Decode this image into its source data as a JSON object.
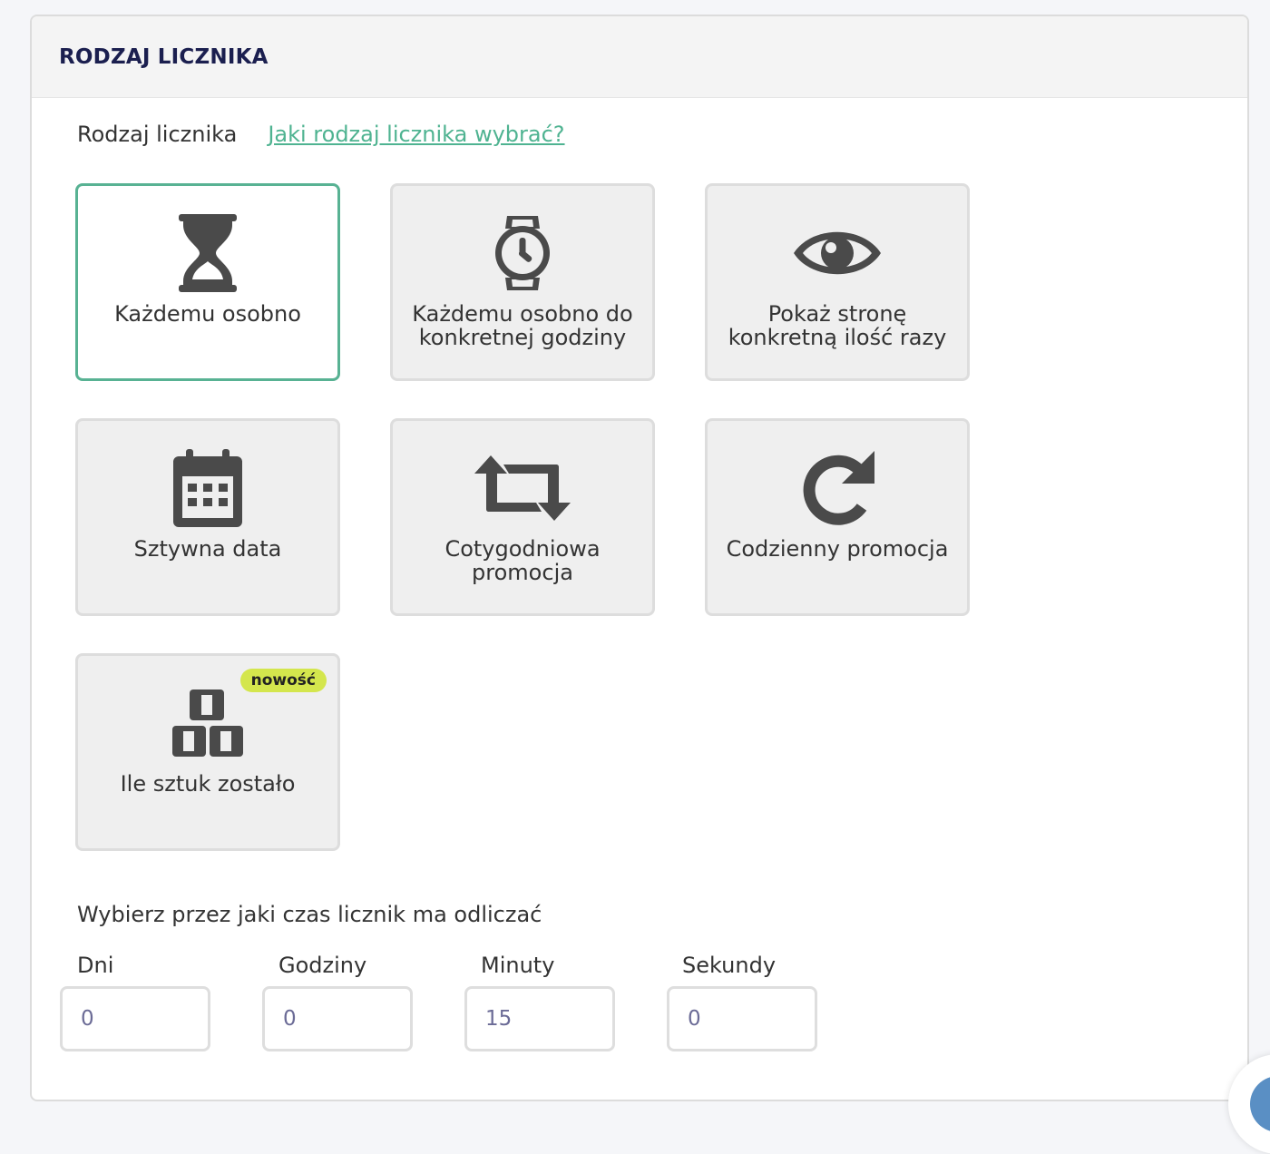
{
  "header": {
    "title": "RODZAJ LICZNIKA"
  },
  "type_section": {
    "label": "Rodzaj licznika",
    "help_link": "Jaki rodzaj licznika wybrać?"
  },
  "tiles": [
    {
      "label": "Każdemu osobno",
      "icon": "hourglass-icon",
      "selected": true
    },
    {
      "label": "Każdemu osobno do konkretnej godziny",
      "icon": "watch-icon",
      "selected": false
    },
    {
      "label": "Pokaż stronę konkretną ilość razy",
      "icon": "eye-icon",
      "selected": false
    },
    {
      "label": "Sztywna data",
      "icon": "calendar-icon",
      "selected": false
    },
    {
      "label": "Cotygodniowa promocja",
      "icon": "repeat-arrows-icon",
      "selected": false
    },
    {
      "label": "Codzienny promocja",
      "icon": "redo-icon",
      "selected": false
    },
    {
      "label": "Ile sztuk zostało",
      "icon": "boxes-icon",
      "selected": false,
      "badge": "nowość"
    }
  ],
  "duration": {
    "label": "Wybierz przez jaki czas licznik ma odliczać",
    "fields": [
      {
        "label": "Dni",
        "value": "0"
      },
      {
        "label": "Godziny",
        "value": "0"
      },
      {
        "label": "Minuty",
        "value": "15"
      },
      {
        "label": "Sekundy",
        "value": "0"
      }
    ]
  },
  "colors": {
    "accent": "#58b293",
    "link": "#4fb391",
    "title": "#1b1f4f",
    "badge": "#d4e64d",
    "icon": "#4a4a4a"
  }
}
